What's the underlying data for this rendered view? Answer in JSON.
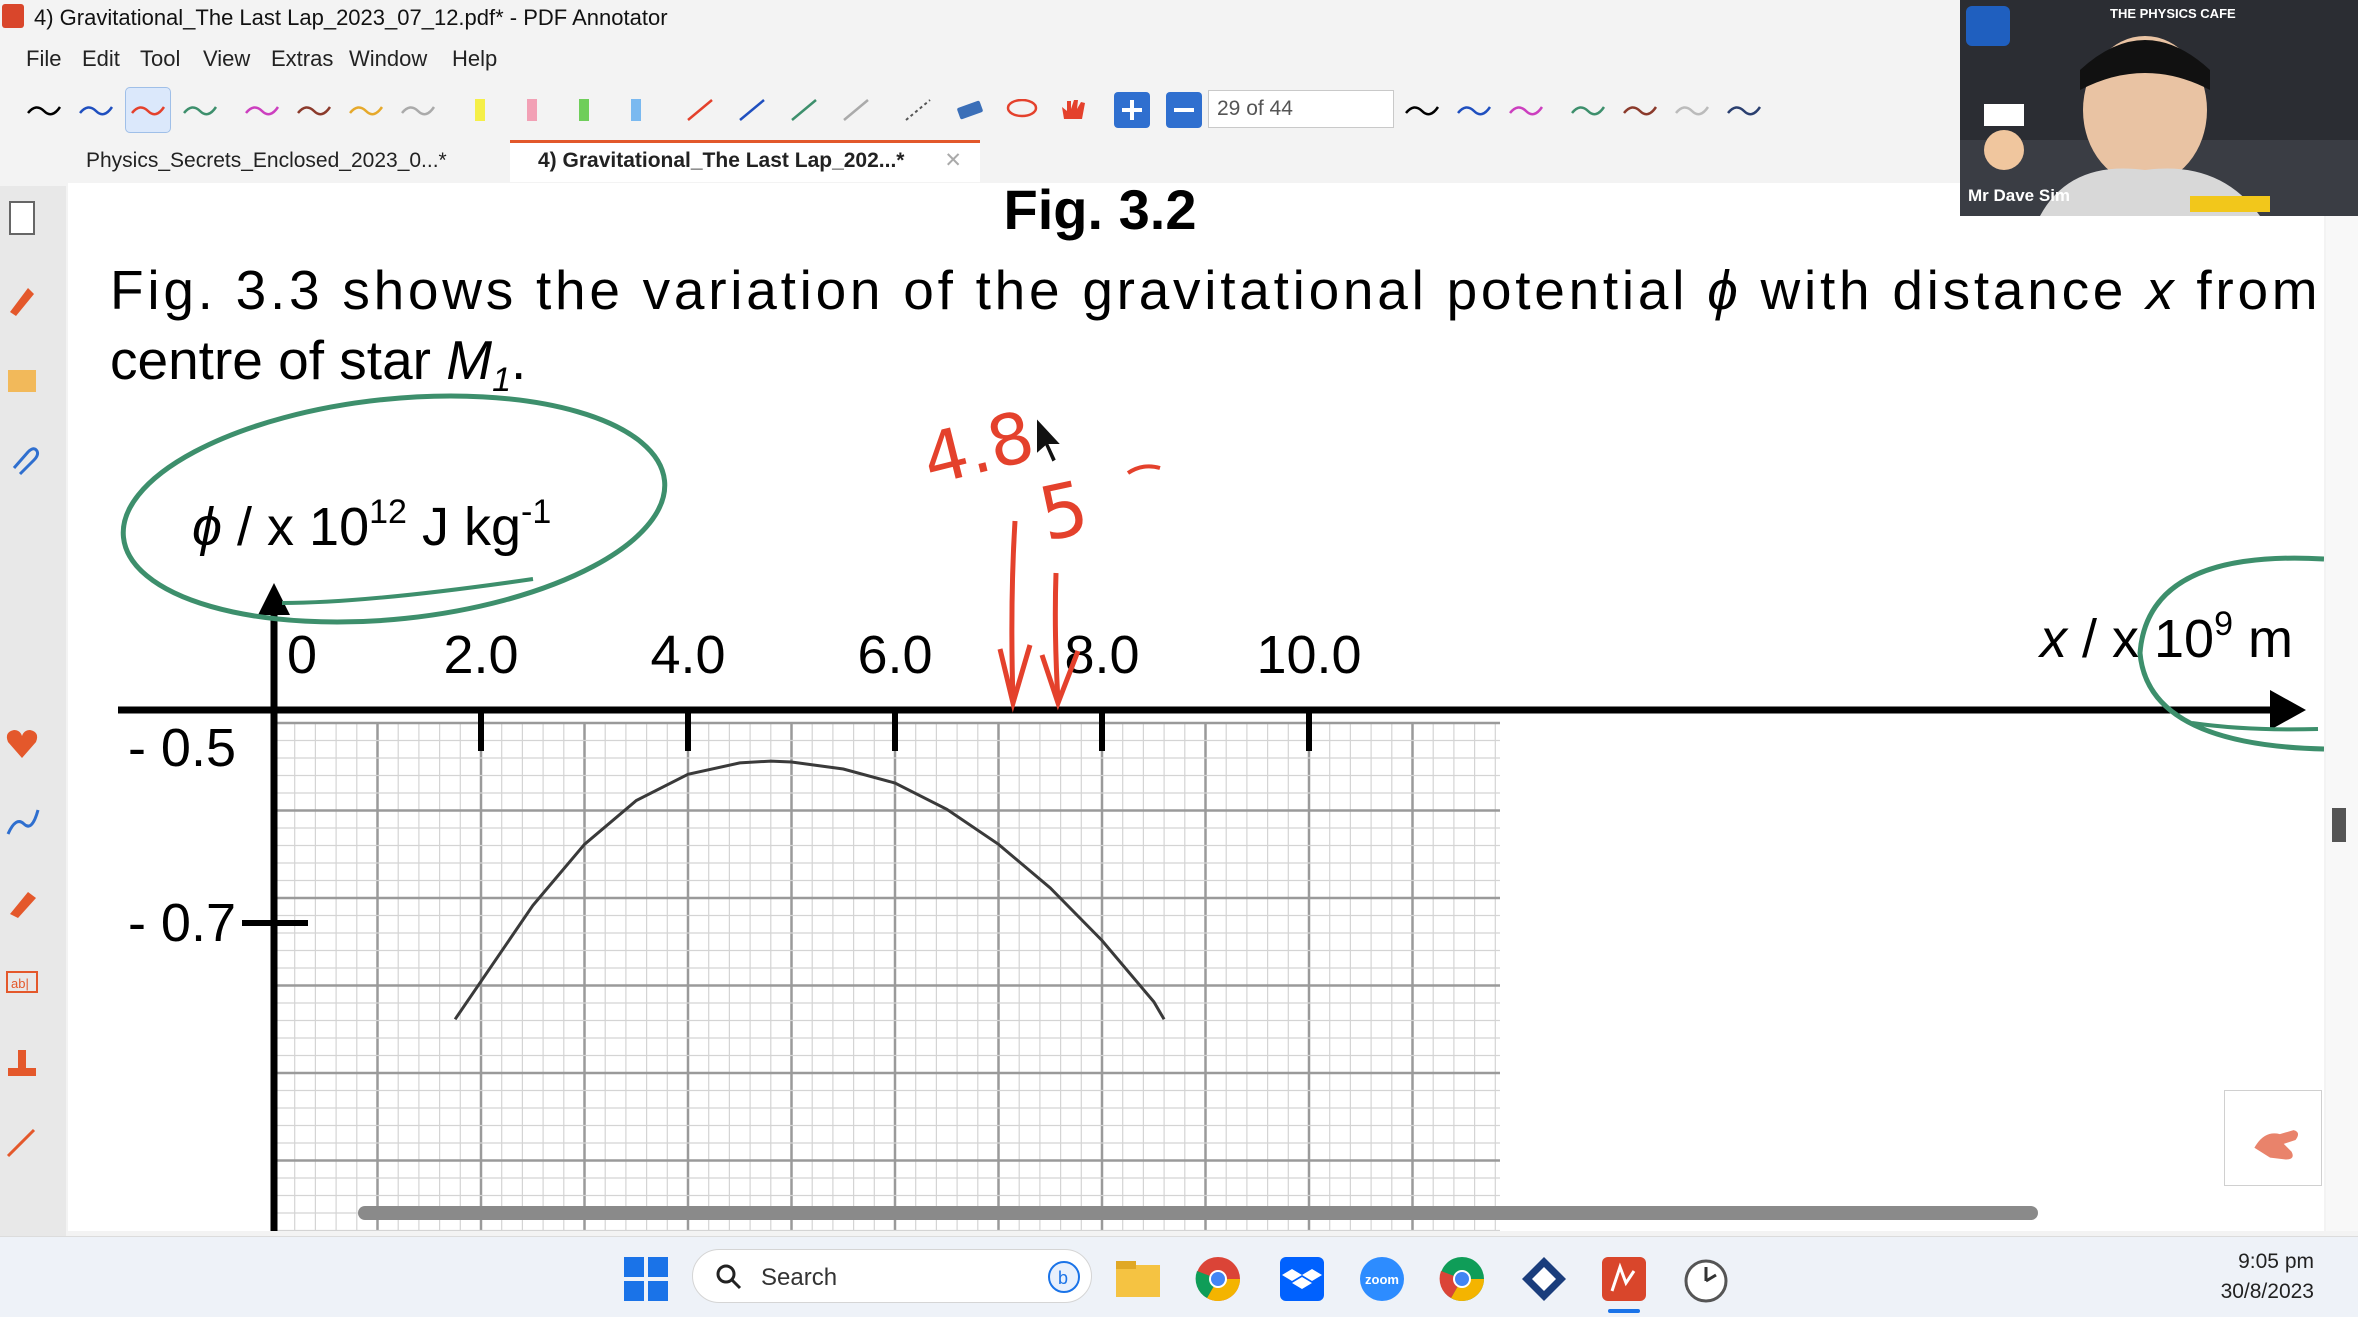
{
  "window": {
    "title": "4) Gravitational_The Last Lap_2023_07_12.pdf* - PDF Annotator"
  },
  "menu": [
    "File",
    "Edit",
    "Tool",
    "View",
    "Extras",
    "Window",
    "Help"
  ],
  "toolbar": {
    "page_indicator": "29 of 44"
  },
  "tabs": [
    {
      "label": "Physics_Secrets_Enclosed_2023_0...*"
    },
    {
      "label": "4) Gravitational_The Last Lap_202...*"
    }
  ],
  "document": {
    "figure_caption": "Fig. 3.2",
    "para_part1": "Fig. 3.3 shows the variation of the gravitational potential ",
    "para_phi": "ϕ",
    "para_part2": " with distance ",
    "para_x": "x",
    "para_part3": " from th",
    "para_line2": "centre of star ",
    "para_M": "M",
    "para_sub": "1",
    "para_end": ".",
    "y_axis_label": {
      "phi": "ϕ",
      "text": " / x 10",
      "exp": "12",
      "unit": " J kg",
      "unit_exp": "-1"
    },
    "x_axis_label": {
      "x": "x",
      "text": " / x 10",
      "exp": "9",
      "unit": " m"
    },
    "handwritten": {
      "estimate1": "4.8",
      "estimate2": "5"
    }
  },
  "chart_data": {
    "type": "line",
    "xlabel": "x / x 10^9 m",
    "ylabel": "ϕ / x 10^12 J kg^-1",
    "x_ticks": [
      "0",
      "2.0",
      "4.0",
      "6.0",
      "8.0",
      "10.0"
    ],
    "y_ticks": [
      "- 0.5",
      "- 0.7"
    ],
    "xlim": [
      0,
      12
    ],
    "ylim": [
      -0.81,
      -0.45
    ],
    "series": [
      {
        "x": [
          1.75,
          2.5,
          3.0,
          3.5,
          4.0,
          4.5,
          4.8,
          5.0,
          5.5,
          6.0,
          6.5,
          7.0,
          7.5,
          8.0,
          8.5,
          8.6
        ],
        "values": [
          -0.81,
          -0.68,
          -0.61,
          -0.56,
          -0.53,
          -0.517,
          -0.515,
          -0.516,
          -0.524,
          -0.54,
          -0.57,
          -0.61,
          -0.66,
          -0.72,
          -0.79,
          -0.81
        ]
      }
    ],
    "grid": true
  },
  "taskbar": {
    "search_placeholder": "Search",
    "time": "9:05 pm",
    "date": "30/8/2023"
  },
  "webcam": {
    "name": "Mr Dave Sim",
    "brand": "THE PHYSICS CAFE"
  },
  "colors": {
    "ink_red": "#e4412c",
    "ink_green": "#3d8f6c",
    "accent_orange": "#e2582b"
  }
}
